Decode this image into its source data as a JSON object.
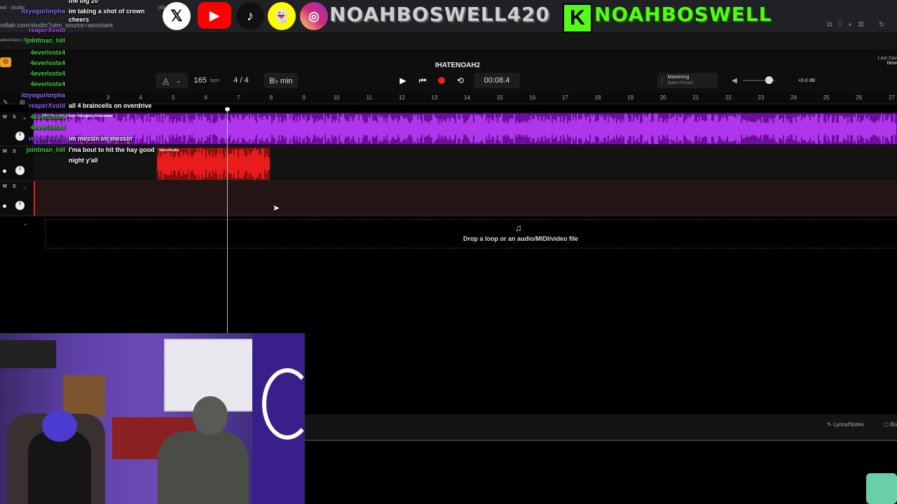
{
  "browser": {
    "url": "ndlab.com/studio?utm_source=assistant",
    "tab_text": "advertisers | BandLab",
    "tab_title": "wd - Studio",
    "status": "(49"
  },
  "social_banner": {
    "handle_main": "NOAHBOSWELL420",
    "kick_letter": "K",
    "kick_handle": "NOAHBOSWELL",
    "icons": [
      "x-icon",
      "youtube-icon",
      "tiktok-icon",
      "snapchat-icon",
      "instagram-icon",
      "kick-icon"
    ]
  },
  "daw": {
    "project_title": "IHATENOAH2",
    "bpm_value": "165",
    "bpm_unit": "bpm",
    "time_signature": "4 / 4",
    "key": "B♭ min",
    "time_display": "00:08.4",
    "mastering_label": "Mastering",
    "mastering_preset": "Select Preset",
    "volume_db": "+0.0 dB",
    "last_saved": "Last Sav",
    "last_saved_sub": "New",
    "ruler": [
      "3",
      "4",
      "5",
      "6",
      "7",
      "8",
      "9",
      "10",
      "11",
      "12",
      "13",
      "14",
      "15",
      "16",
      "17",
      "18",
      "19",
      "20",
      "21",
      "22",
      "23",
      "24",
      "25",
      "26",
      "27"
    ],
    "tracks": [
      {
        "clip_label": "NBA Youngboy Kate Youngboy Instrument",
        "color": "#a020f0"
      },
      {
        "clip_label": "Voice/Audio",
        "color": "#e01818"
      },
      {
        "clip_label": "",
        "color": "#3a1e1e"
      }
    ],
    "ms_labels": [
      "M",
      "S"
    ],
    "drop_text": "Drop a loop or an audio/MIDI/video file",
    "lyrics_button": "Lyrics/Notes",
    "extra_button": "Bo"
  },
  "chat": [
    {
      "user": "",
      "msg": "the big 20",
      "color": "#ffffff"
    },
    {
      "user": "itzyogurlorpha",
      "msg": "im taking a shot of crown",
      "color": "#8a6cff"
    },
    {
      "user": "",
      "msg": "cheers",
      "color": "#ffffff"
    },
    {
      "user": "reaperXvoid",
      "msg": "",
      "color": "#a050ff"
    },
    {
      "user": "jointman_hill",
      "msg": "",
      "color": "#3ecf3e"
    },
    {
      "user": "4everlostx4",
      "msg": "",
      "color": "#3ecf3e"
    },
    {
      "user": "4everlostx4",
      "msg": "",
      "color": "#3ecf3e"
    },
    {
      "user": "4everlostx4",
      "msg": "",
      "color": "#3ecf3e"
    },
    {
      "user": "4everlostx4",
      "msg": "",
      "color": "#3ecf3e"
    },
    {
      "user": "itzyogurlorpha",
      "msg": "",
      "color": "#8a6cff"
    },
    {
      "user": "reaperXvoid",
      "msg": "all 4 braincells on overdrive",
      "color": "#a050ff"
    },
    {
      "user": "4everlostx4",
      "msg": "",
      "color": "#3ecf3e"
    },
    {
      "user": "4everlostx4",
      "msg": "",
      "color": "#3ecf3e"
    },
    {
      "user": "reaperXvoid",
      "msg": "im messin im messin",
      "color": "#a050ff"
    },
    {
      "user": "jointman_hill",
      "msg": "I'ma bout to hit the hay good",
      "color": "#3ecf3e"
    },
    {
      "user": "",
      "msg": "night y'all",
      "color": "#ffffff"
    }
  ]
}
